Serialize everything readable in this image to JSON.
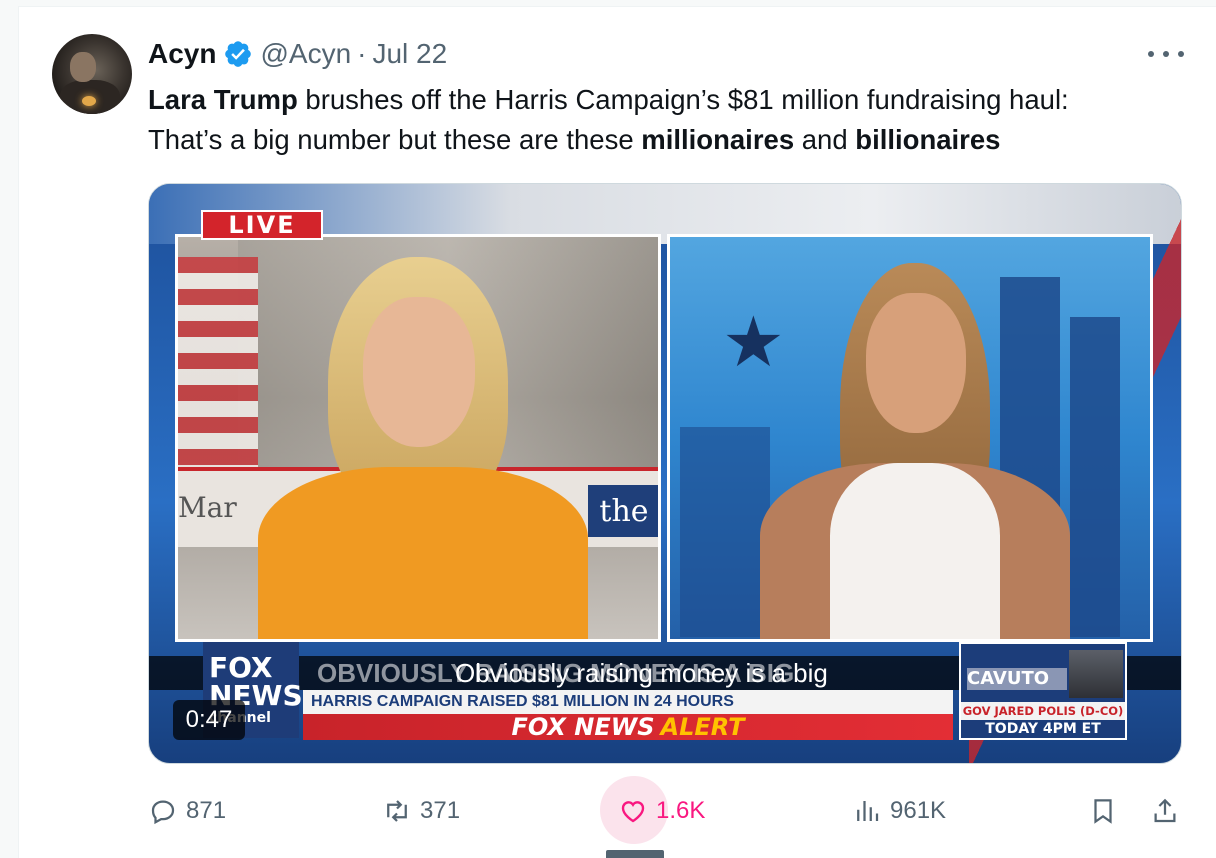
{
  "post": {
    "author": {
      "display_name": "Acyn",
      "handle": "@Acyn",
      "verified": true,
      "avatar_icon": "avatar"
    },
    "separator": "·",
    "date": "Jul 22",
    "text": {
      "bold1": "Lara Trump",
      "part1": " brushes off the Harris Campaign’s $81 million fundraising haul:",
      "part2": "That’s a big number but these are these ",
      "bold2": "millionaires",
      "part3": " and ",
      "bold3": "billionaires"
    },
    "video": {
      "live_badge": "LIVE",
      "caption": "Obviously raising money is a big",
      "background_chyron": "OBVIOUSLY RAISING MONEY IS A BIG",
      "chyron_top": "HARRIS CAMPAIGN RAISED $81 MILLION IN 24 HOURS",
      "alert_prefix": "FOX NEWS",
      "alert_suffix": "ALERT",
      "network_logo": [
        "FOX",
        "NEWS",
        "channel"
      ],
      "sign_left": "Mar",
      "sign_right": "the",
      "promo": {
        "show": "CAVUTO",
        "guest": "GOV JARED POLIS (D-CO)",
        "time": "TODAY 4PM ET"
      },
      "duration": "0:47"
    },
    "actions": {
      "replies": "871",
      "reposts": "371",
      "likes": "1.6K",
      "views": "961K"
    },
    "colors": {
      "verified_blue": "#1d9bf0",
      "like_pink": "#f91880",
      "secondary_text": "#536471"
    }
  }
}
